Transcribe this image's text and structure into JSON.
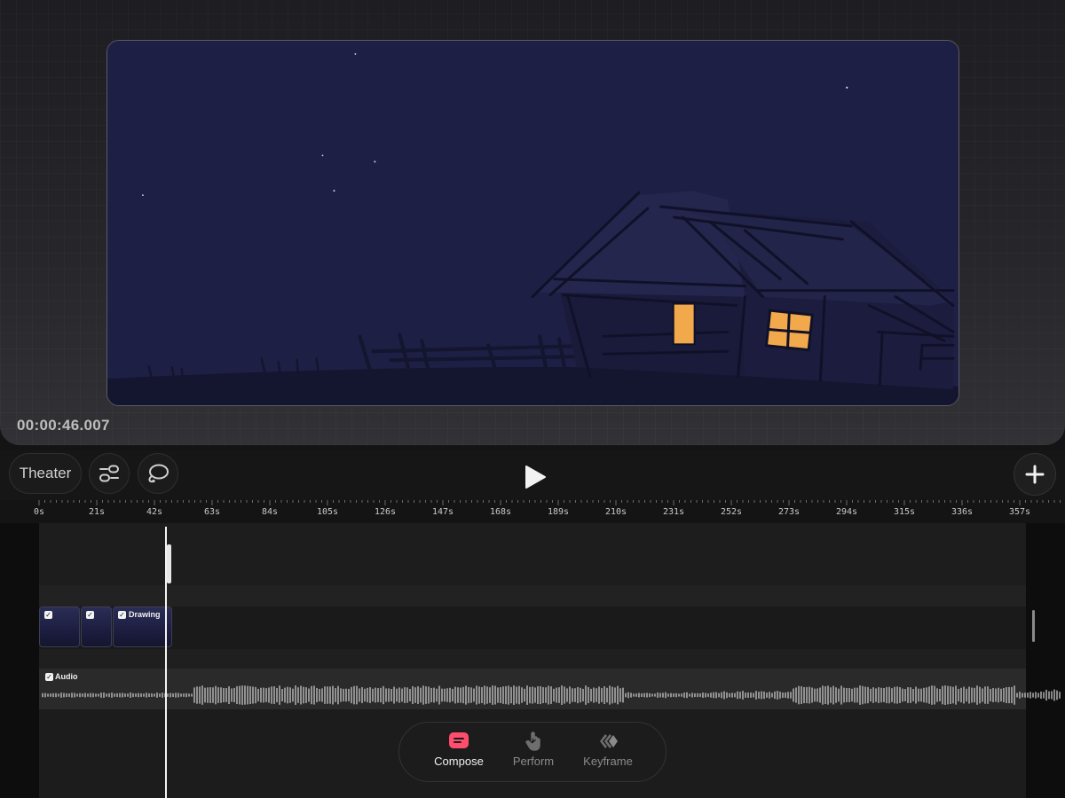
{
  "preview": {
    "timecode": "00:00:46.007"
  },
  "toolbar": {
    "theater_label": "Theater",
    "settings_icon": "sliders-icon",
    "lasso_icon": "lasso-icon",
    "play_icon": "play-icon",
    "add_icon": "plus-icon"
  },
  "ruler": {
    "ticks": [
      "0s",
      "21s",
      "42s",
      "63s",
      "84s",
      "105s",
      "126s",
      "147s",
      "168s",
      "189s",
      "210s",
      "231s",
      "252s",
      "273s",
      "294s",
      "315s",
      "336s",
      "357s"
    ]
  },
  "tracks": {
    "clips": [
      {
        "label": "",
        "checked": true
      },
      {
        "label": "",
        "checked": true
      },
      {
        "label": "Drawing",
        "checked": true
      }
    ],
    "audio": {
      "label": "Audio",
      "checked": true
    }
  },
  "modes": {
    "compose": "Compose",
    "perform": "Perform",
    "keyframe": "Keyframe",
    "active": "Compose",
    "accent_color": "#ff4d6d"
  },
  "colors": {
    "window_light": "#f2a94c",
    "sky": "#1e1f44"
  }
}
